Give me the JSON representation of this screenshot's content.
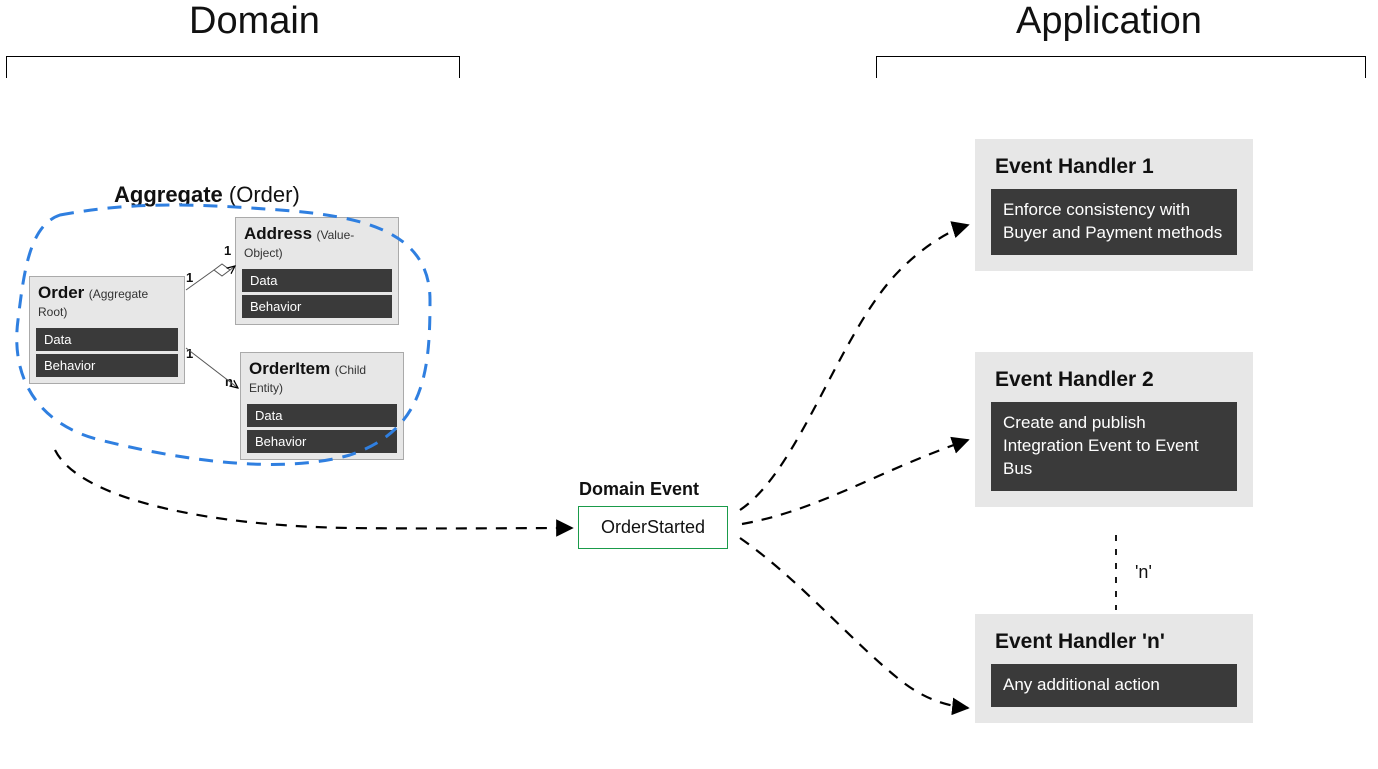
{
  "sections": {
    "domain": "Domain",
    "application": "Application"
  },
  "aggregate": {
    "label_bold": "Aggregate",
    "label_plain": " (Order)"
  },
  "entities": {
    "order": {
      "name": "Order",
      "stereotype": "(Aggregate Root)",
      "row1": "Data",
      "row2": "Behavior"
    },
    "address": {
      "name": "Address",
      "stereotype": "(Value-Object)",
      "row1": "Data",
      "row2": "Behavior"
    },
    "orderItem": {
      "name": "OrderItem",
      "stereotype": "(Child Entity)",
      "row1": "Data",
      "row2": "Behavior"
    }
  },
  "multiplicity": {
    "one_a": "1",
    "one_b": "1",
    "one_c": "1",
    "n": "n"
  },
  "domainEvent": {
    "label": "Domain Event",
    "name": "OrderStarted"
  },
  "handlers": {
    "h1": {
      "title": "Event Handler 1",
      "desc": "Enforce consistency with Buyer and Payment methods"
    },
    "h2": {
      "title": "Event Handler 2",
      "desc": "Create and publish Integration Event to Event Bus"
    },
    "hn": {
      "title": "Event Handler 'n'",
      "desc": "Any additional action"
    }
  },
  "n_dots_label": "'n'"
}
